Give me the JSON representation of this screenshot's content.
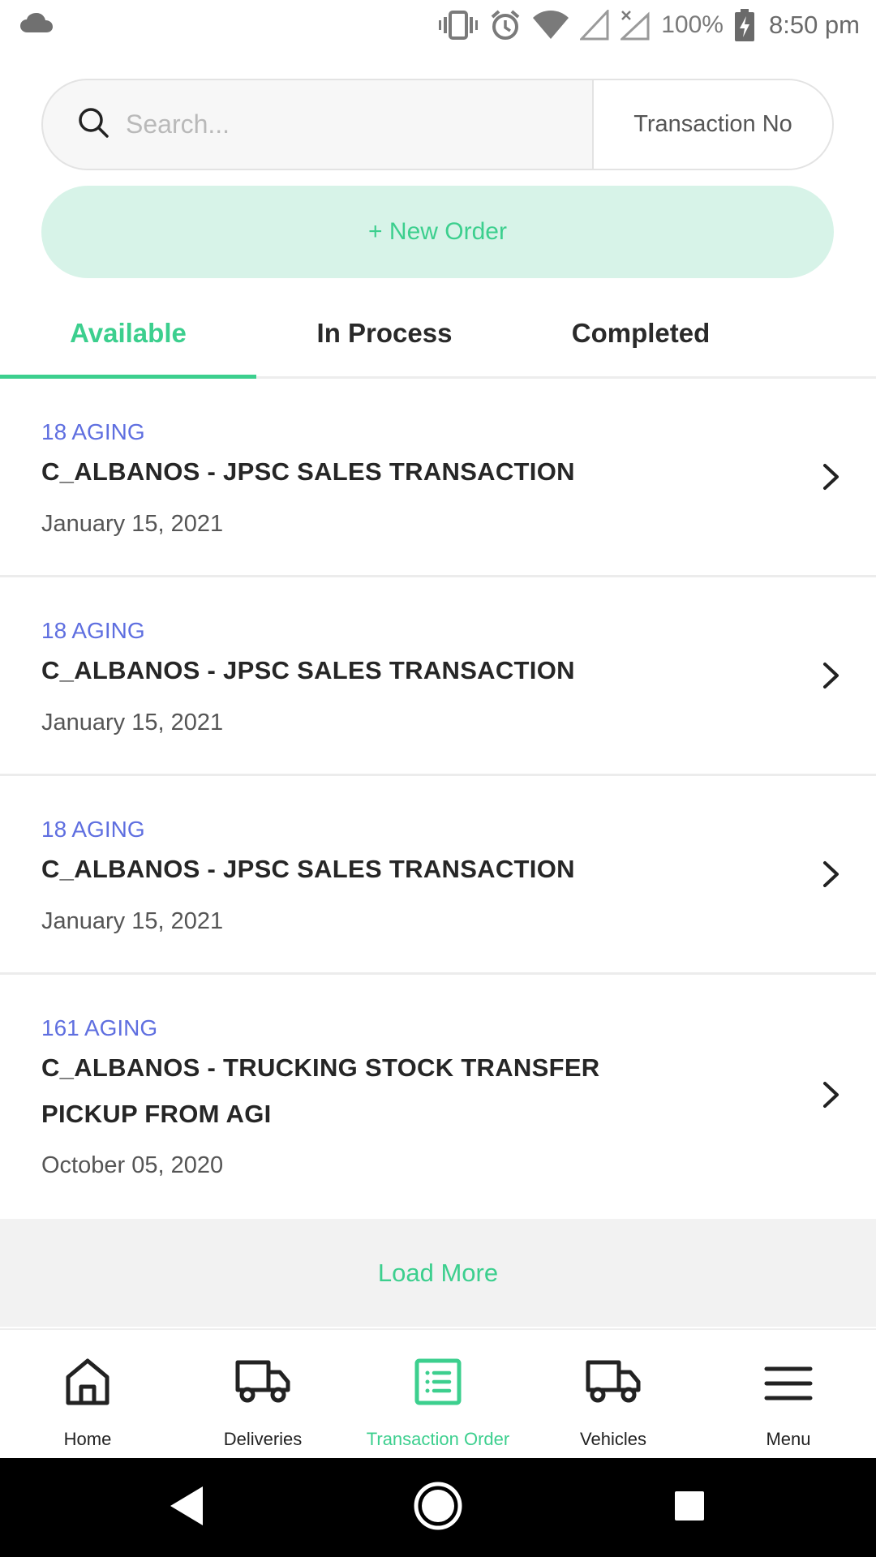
{
  "status_bar": {
    "battery": "100%",
    "time": "8:50 pm"
  },
  "search": {
    "placeholder": "Search...",
    "value": "",
    "filter_label": "Transaction No"
  },
  "new_order_label": "+ New Order",
  "tabs": [
    {
      "label": "Available",
      "active": true
    },
    {
      "label": "In Process",
      "active": false
    },
    {
      "label": "Completed",
      "active": false
    }
  ],
  "transactions": [
    {
      "aging": "18 AGING",
      "title": "C_ALBANOS - JPSC SALES TRANSACTION",
      "date": "January 15, 2021"
    },
    {
      "aging": "18 AGING",
      "title": "C_ALBANOS - JPSC SALES TRANSACTION",
      "date": "January 15, 2021"
    },
    {
      "aging": "18 AGING",
      "title": "C_ALBANOS - JPSC SALES TRANSACTION",
      "date": "January 15, 2021"
    },
    {
      "aging": "161 AGING",
      "title": "C_ALBANOS - TRUCKING STOCK TRANSFER PICKUP FROM AGI",
      "date": "October 05, 2020"
    }
  ],
  "load_more_label": "Load More",
  "bottom_nav": [
    {
      "label": "Home",
      "icon": "home-icon",
      "active": false
    },
    {
      "label": "Deliveries",
      "icon": "truck-icon",
      "active": false
    },
    {
      "label": "Transaction Order",
      "icon": "list-icon",
      "active": true
    },
    {
      "label": "Vehicles",
      "icon": "truck-icon",
      "active": false
    },
    {
      "label": "Menu",
      "icon": "menu-icon",
      "active": false
    }
  ],
  "colors": {
    "accent": "#3ccf8e",
    "accent_light": "#d7f3e8",
    "aging": "#5f6fe0"
  }
}
